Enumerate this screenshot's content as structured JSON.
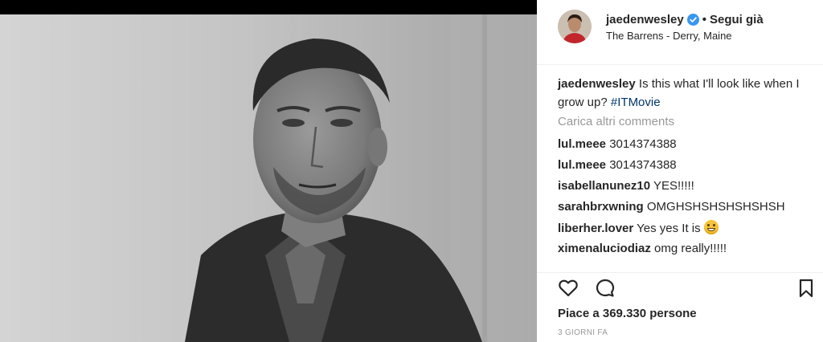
{
  "post": {
    "author": {
      "username": "jaedenwesley",
      "verified": true,
      "separator": "•",
      "follow_label": "Segui già",
      "location": "The Barrens - Derry, Maine",
      "avatar_icon": "profile-avatar"
    },
    "photo": {
      "style": "black-and-white portrait",
      "icon": "portrait-photo"
    },
    "caption": {
      "username": "jaedenwesley",
      "text": "Is this what I'll look like when I grow up?",
      "hashtag": "#ITMovie"
    },
    "load_more_label": "Carica altri comments",
    "comments": [
      {
        "username": "lul.meee",
        "text": "3014374388"
      },
      {
        "username": "lul.meee",
        "text": "3014374388"
      },
      {
        "username": "isabellanunez10",
        "text": "YES!!!!!"
      },
      {
        "username": "sarahbrxwning",
        "text": "OMGHSHSHSHSHSHSH"
      },
      {
        "username": "liberher.lover",
        "text": "Yes yes It is",
        "emoji": "grinning-face-emoji"
      },
      {
        "username": "ximenaluciodiaz",
        "text": "omg really!!!!!"
      }
    ],
    "actions": {
      "like_icon": "heart-icon",
      "comment_icon": "comment-icon",
      "save_icon": "bookmark-icon"
    },
    "likes_text": "Piace a 369.330 persone",
    "timestamp": "3 GIORNI FA",
    "colors": {
      "hashtag": "#003569",
      "muted": "#999999",
      "verified": "#3897f0",
      "text": "#262626"
    }
  }
}
